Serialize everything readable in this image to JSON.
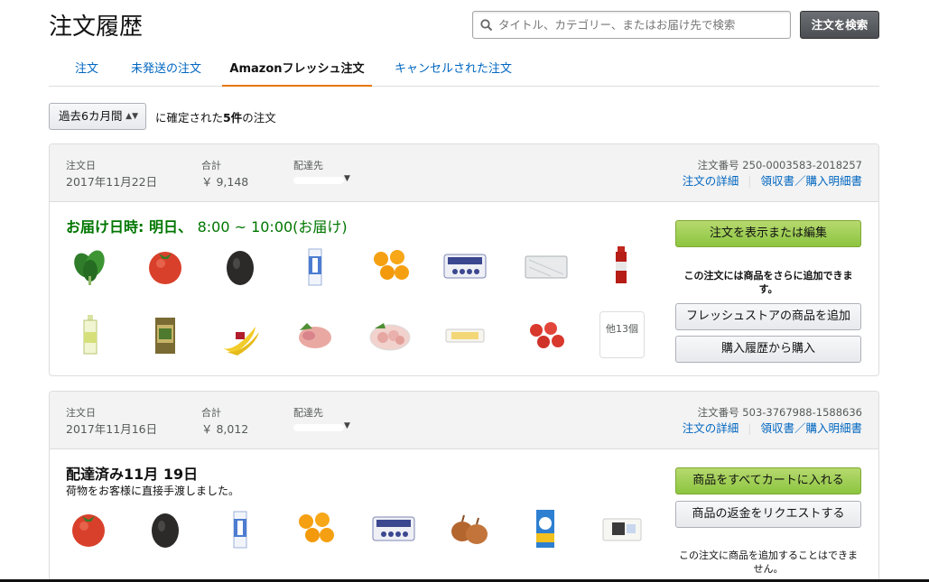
{
  "page": {
    "title": "注文履歴"
  },
  "search": {
    "placeholder": "タイトル、カテゴリー、またはお届け先で検索",
    "button_label": "注文を検索"
  },
  "tabs": [
    {
      "label": "注文"
    },
    {
      "label": "未発送の注文"
    },
    {
      "label": "Amazonフレッシュ注文",
      "active": true
    },
    {
      "label": "キャンセルされた注文"
    }
  ],
  "filter": {
    "selected": "過去6カ月間",
    "prefix": "に確定された",
    "count": "5件",
    "suffix": "の注文"
  },
  "orders": [
    {
      "date_label": "注文日",
      "date": "2017年11月22日",
      "total_label": "合計",
      "total": "￥ 9,148",
      "ship_label": "配達先",
      "order_no": "注文番号 250-0003583-2018257",
      "details_link": "注文の詳細",
      "receipt_link": "領収書／購入明細書",
      "status_bold": "お届け日時: 明日、",
      "status_time": "8:00 ~ 10:00(お届け)",
      "items_row1": [
        "spinach-icon",
        "tomato-icon",
        "avocado-icon",
        "milk-carton-icon",
        "mandarin-oranges-icon",
        "blueberry-pack-icon",
        "bag-pack-icon",
        "red-bottle-icon"
      ],
      "items_row2": [
        "green-bottle-icon",
        "tea-box-icon",
        "bananas-icon",
        "chicken-meat-icon",
        "chicken-pack-icon",
        "cheese-pack-icon",
        "red-apples-icon"
      ],
      "more_items": "他13個",
      "btn_view_edit": "注文を表示または編集",
      "note_add": "この注文には商品をさらに追加できます。",
      "btn_add_fresh": "フレッシュストアの商品を追加",
      "btn_buy_history": "購入履歴から購入"
    },
    {
      "date_label": "注文日",
      "date": "2017年11月16日",
      "total_label": "合計",
      "total": "￥ 8,012",
      "ship_label": "配達先",
      "order_no": "注文番号 503-3767988-1588636",
      "details_link": "注文の詳細",
      "receipt_link": "領収書／購入明細書",
      "status": "配達済み11月 19日",
      "status_sub": "荷物をお客様に直接手渡しました。",
      "items_row1": [
        "tomato-icon",
        "avocado-icon",
        "milk-carton-icon",
        "mandarin-oranges-icon",
        "blueberry-pack-icon",
        "onions-icon",
        "detergent-bottle-icon",
        "tofu-pack-icon"
      ],
      "btn_all_cart": "商品をすべてカートに入れる",
      "btn_refund": "商品の返金をリクエストする",
      "note_no_add": "この注文に商品を追加することはできません。"
    }
  ],
  "colors": {
    "link": "#0066c0",
    "green_status": "#007600",
    "tab_underline": "#e77600",
    "primary_button": "#a4d15a"
  }
}
